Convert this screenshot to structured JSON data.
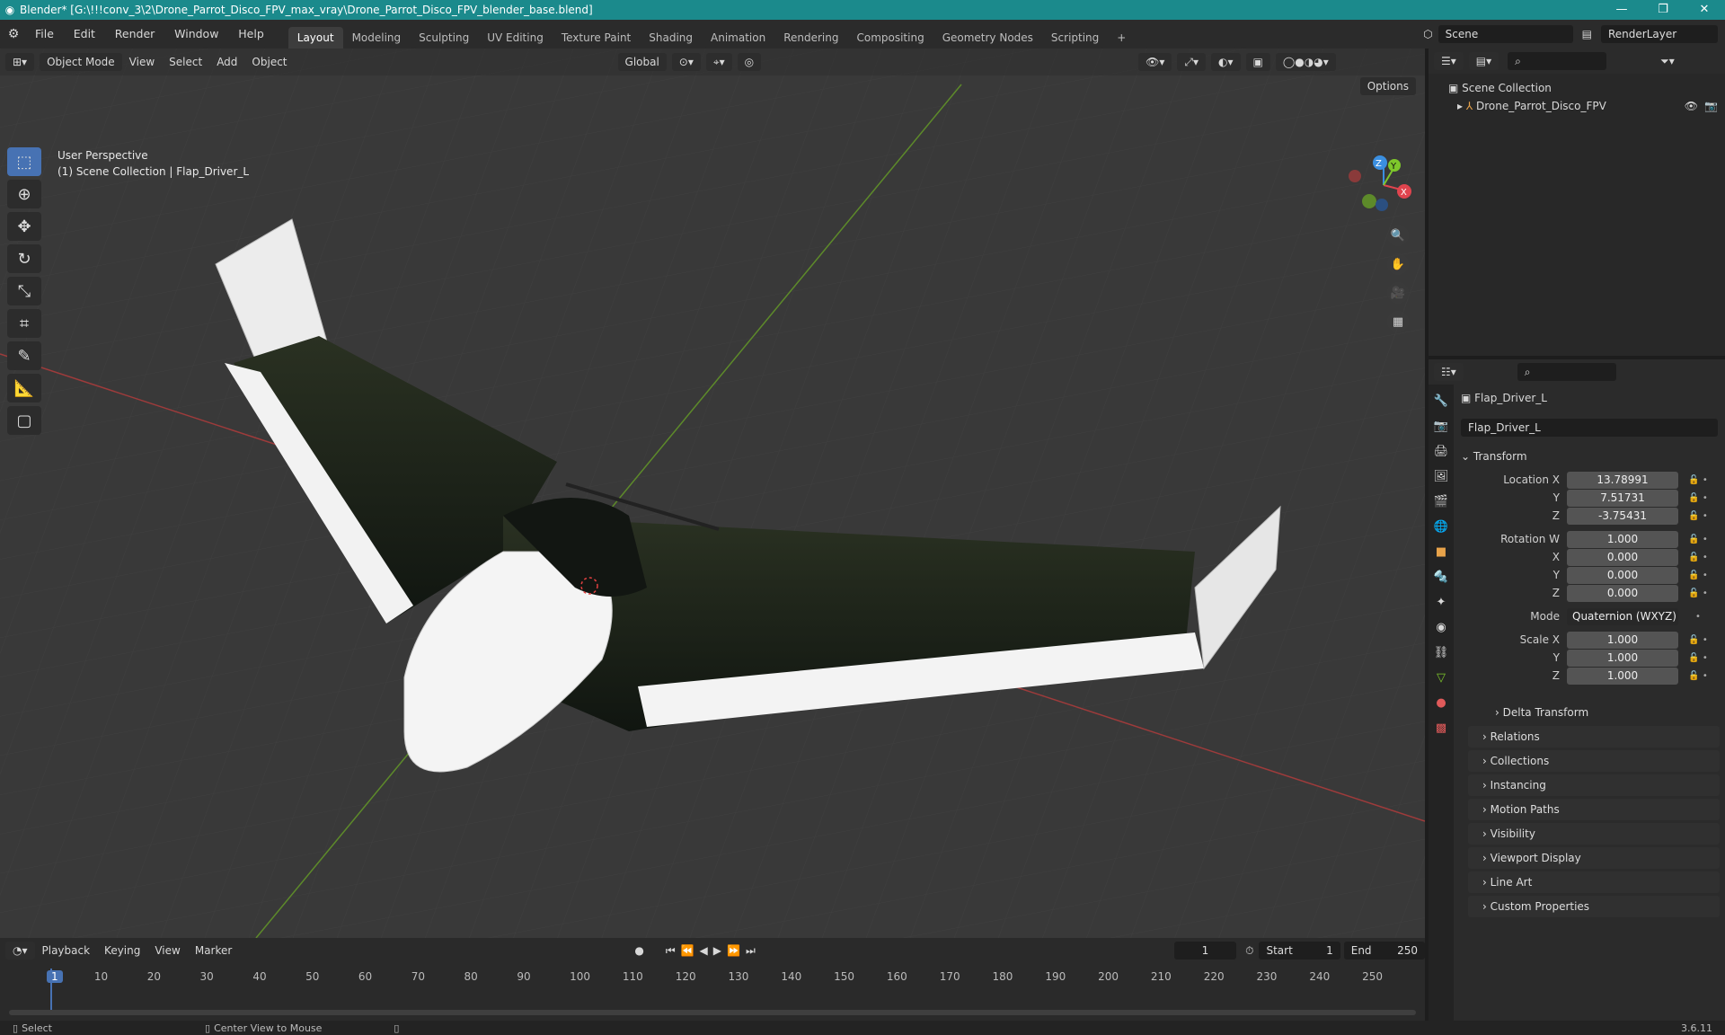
{
  "window": {
    "title": "Blender* [G:\\!!!conv_3\\2\\Drone_Parrot_Disco_FPV_max_vray\\Drone_Parrot_Disco_FPV_blender_base.blend]",
    "minimize": "—",
    "maximize": "❐",
    "close": "✕"
  },
  "menu": [
    "File",
    "Edit",
    "Render",
    "Window",
    "Help"
  ],
  "workspaces": [
    "Layout",
    "Modeling",
    "Sculpting",
    "UV Editing",
    "Texture Paint",
    "Shading",
    "Animation",
    "Rendering",
    "Compositing",
    "Geometry Nodes",
    "Scripting",
    "+"
  ],
  "scene": {
    "name": "Scene",
    "render_layer": "RenderLayer"
  },
  "viewport": {
    "mode": "Object Mode",
    "menus": [
      "View",
      "Select",
      "Add",
      "Object"
    ],
    "orientation": "Global",
    "options": "Options",
    "perspective": "User Perspective",
    "collection_line": "(1) Scene Collection | Flap_Driver_L",
    "gizmo": {
      "x": "X",
      "y": "Y",
      "z": "Z"
    }
  },
  "outliner": {
    "root": "Scene Collection",
    "item": "Drone_Parrot_Disco_FPV"
  },
  "properties": {
    "object_name": "Flap_Driver_L",
    "data_name": "Flap_Driver_L",
    "transform": "Transform",
    "location": {
      "label": "Location X",
      "x": "13.78991",
      "y": "7.51731",
      "z": "-3.75431"
    },
    "rotation": {
      "label": "Rotation W",
      "w": "1.000",
      "x": "0.000",
      "y": "0.000",
      "z": "0.000"
    },
    "mode": {
      "label": "Mode",
      "value": "Quaternion (WXYZ)"
    },
    "scale": {
      "label": "Scale X",
      "x": "1.000",
      "y": "1.000",
      "z": "1.000"
    },
    "axis": {
      "y": "Y",
      "z": "Z",
      "x": "X"
    },
    "panels": [
      "Delta Transform",
      "Relations",
      "Collections",
      "Instancing",
      "Motion Paths",
      "Visibility",
      "Viewport Display",
      "Line Art",
      "Custom Properties"
    ]
  },
  "timeline": {
    "menus": [
      "Playback",
      "Keying",
      "View",
      "Marker"
    ],
    "current": "1",
    "start_label": "Start",
    "start": "1",
    "end_label": "End",
    "end": "250",
    "ticks": [
      "1",
      "10",
      "20",
      "30",
      "40",
      "50",
      "60",
      "70",
      "80",
      "90",
      "100",
      "110",
      "120",
      "130",
      "140",
      "150",
      "160",
      "170",
      "180",
      "190",
      "200",
      "210",
      "220",
      "230",
      "240",
      "250"
    ]
  },
  "status": {
    "select": "Select",
    "center": "Center View to Mouse",
    "version": "3.6.11"
  },
  "colors": {
    "title": "#1b8a8c",
    "accent": "#4772b3",
    "x_axis": "#e0444e",
    "y_axis": "#7ec72b",
    "z_axis": "#3b8fe0"
  }
}
